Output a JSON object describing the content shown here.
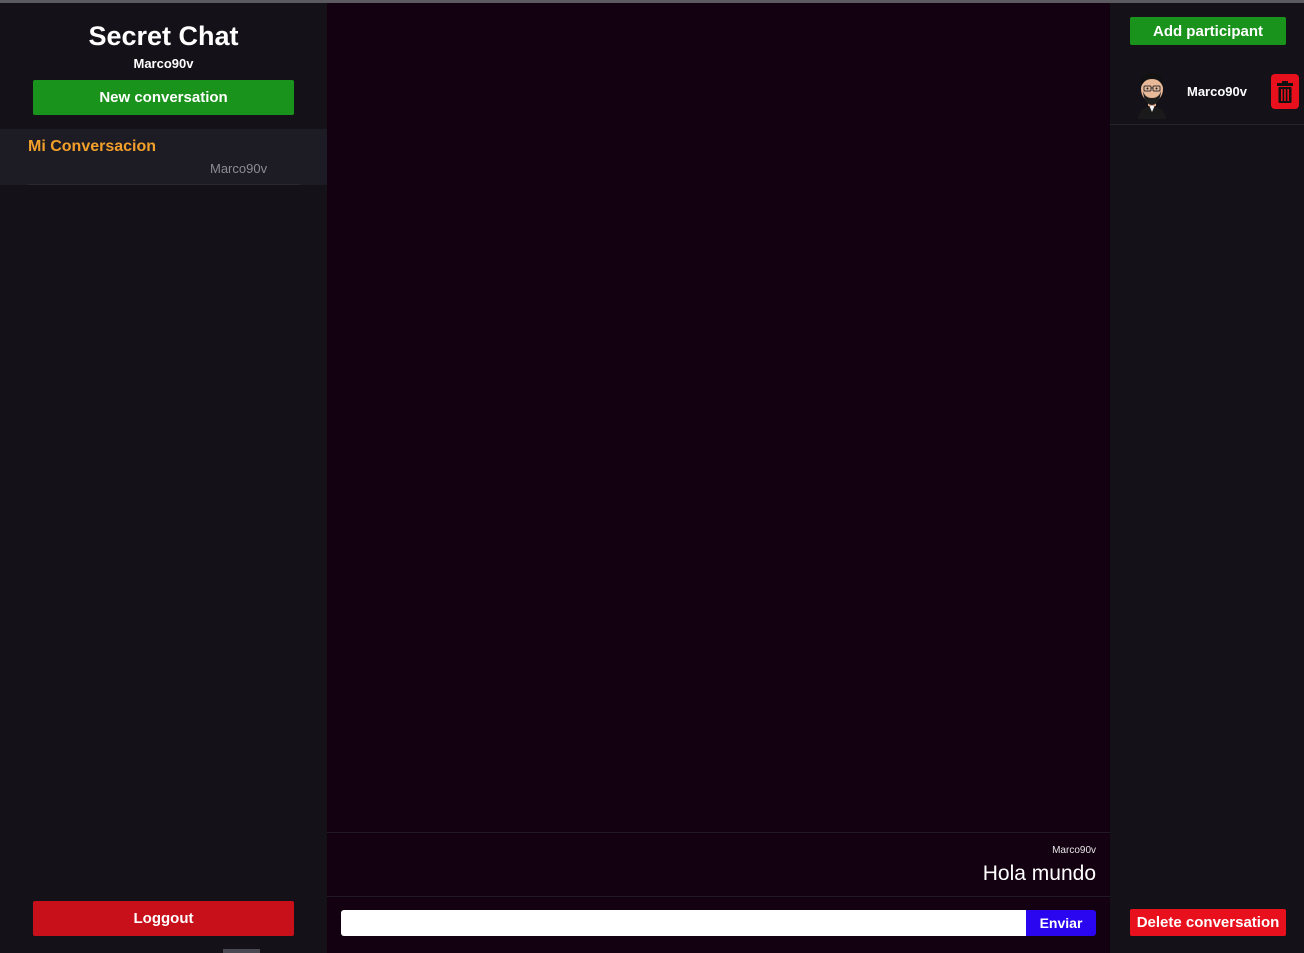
{
  "sidebar": {
    "app_title": "Secret Chat",
    "username": "Marco90v",
    "new_conversation_label": "New conversation",
    "conversations": [
      {
        "title": "Mi Conversacion",
        "owner": "Marco90v"
      }
    ],
    "logout_label": "Loggout"
  },
  "chat": {
    "messages": [
      {
        "author": "Marco90v",
        "text": "Hola mundo"
      }
    ],
    "input": {
      "value": "",
      "placeholder": ""
    },
    "send_label": "Enviar"
  },
  "participants_panel": {
    "add_participant_label": "Add participant",
    "participants": [
      {
        "name": "Marco90v",
        "avatar": "bearded-man-avatar",
        "remove_icon": "trash-icon"
      }
    ],
    "delete_conversation_label": "Delete conversation"
  },
  "colors": {
    "accent_green": "#1a931c",
    "danger_red": "#e8101d",
    "logout_red": "#c8101b",
    "send_blue": "#2a06f0",
    "conversation_title": "#f2a02b",
    "chat_background": "#130010",
    "sidebar_background": "#141218"
  }
}
